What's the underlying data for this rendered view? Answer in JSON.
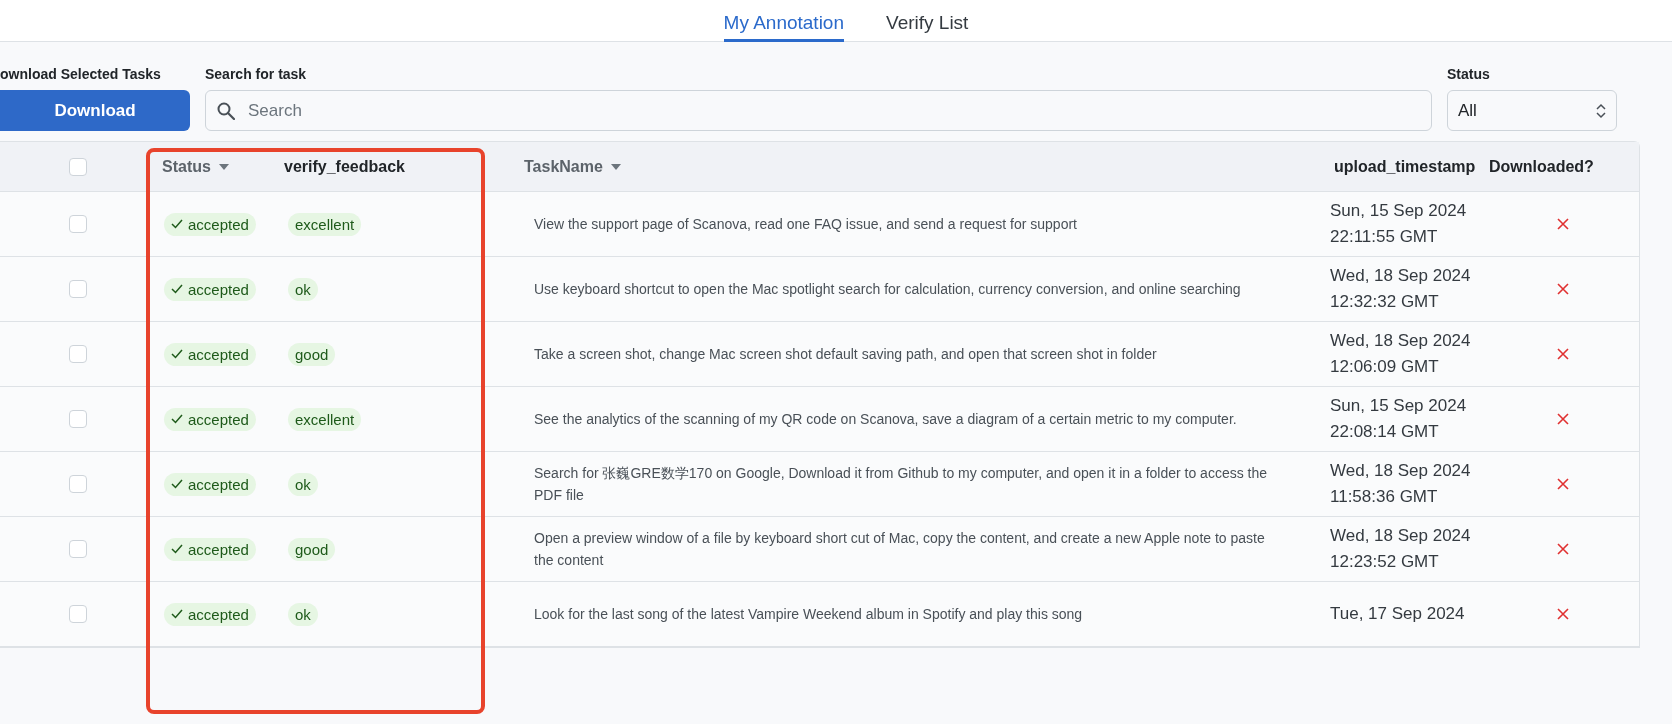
{
  "tabs": [
    {
      "label": "My Annotation",
      "selected": true
    },
    {
      "label": "Verify List",
      "selected": false
    }
  ],
  "toolbar": {
    "download_label": "ownload Selected Tasks",
    "download_button": "Download",
    "search_label": "Search for task",
    "search_placeholder": "Search",
    "status_label": "Status",
    "status_value": "All"
  },
  "table": {
    "select_all_checked": false,
    "columns": [
      {
        "label": "Status",
        "sortable": true
      },
      {
        "label": "verify_feedback",
        "sortable": false
      },
      {
        "label": "TaskName",
        "sortable": true
      },
      {
        "label": "upload_timestamp",
        "sortable": false
      },
      {
        "label": "Downloaded?",
        "sortable": false
      }
    ],
    "rows": [
      {
        "checked": false,
        "status": "accepted",
        "feedback": "excellent",
        "task": "View the support page of Scanova, read one FAQ issue, and send a request for support",
        "timestamp": "Sun, 15 Sep 2024 22:11:55 GMT",
        "downloaded": false
      },
      {
        "checked": false,
        "status": "accepted",
        "feedback": "ok",
        "task": "Use keyboard shortcut to open the Mac spotlight search for calculation, currency conversion, and online searching",
        "timestamp": "Wed, 18 Sep 2024 12:32:32 GMT",
        "downloaded": false
      },
      {
        "checked": false,
        "status": "accepted",
        "feedback": "good",
        "task": "Take a screen shot, change Mac screen shot default saving path, and open that screen shot in folder",
        "timestamp": "Wed, 18 Sep 2024 12:06:09 GMT",
        "downloaded": false
      },
      {
        "checked": false,
        "status": "accepted",
        "feedback": "excellent",
        "task": "See the analytics of the scanning of my QR code on Scanova, save a diagram of a certain metric to my computer.",
        "timestamp": "Sun, 15 Sep 2024 22:08:14 GMT",
        "downloaded": false
      },
      {
        "checked": false,
        "status": "accepted",
        "feedback": "ok",
        "task": "Search for 张巍GRE数学170 on Google, Download it from Github to my computer, and open it in a folder to access the PDF file",
        "timestamp": "Wed, 18 Sep 2024 11:58:36 GMT",
        "downloaded": false
      },
      {
        "checked": false,
        "status": "accepted",
        "feedback": "good",
        "task": "Open a preview window of a file by keyboard short cut of Mac, copy the content, and create a new Apple note to paste the content",
        "timestamp": "Wed, 18 Sep 2024 12:23:52 GMT",
        "downloaded": false
      },
      {
        "checked": false,
        "status": "accepted",
        "feedback": "ok",
        "task": "Look for the last song of the latest Vampire Weekend album in Spotify and play this song",
        "timestamp": "Tue, 17 Sep 2024",
        "downloaded": false
      }
    ]
  }
}
